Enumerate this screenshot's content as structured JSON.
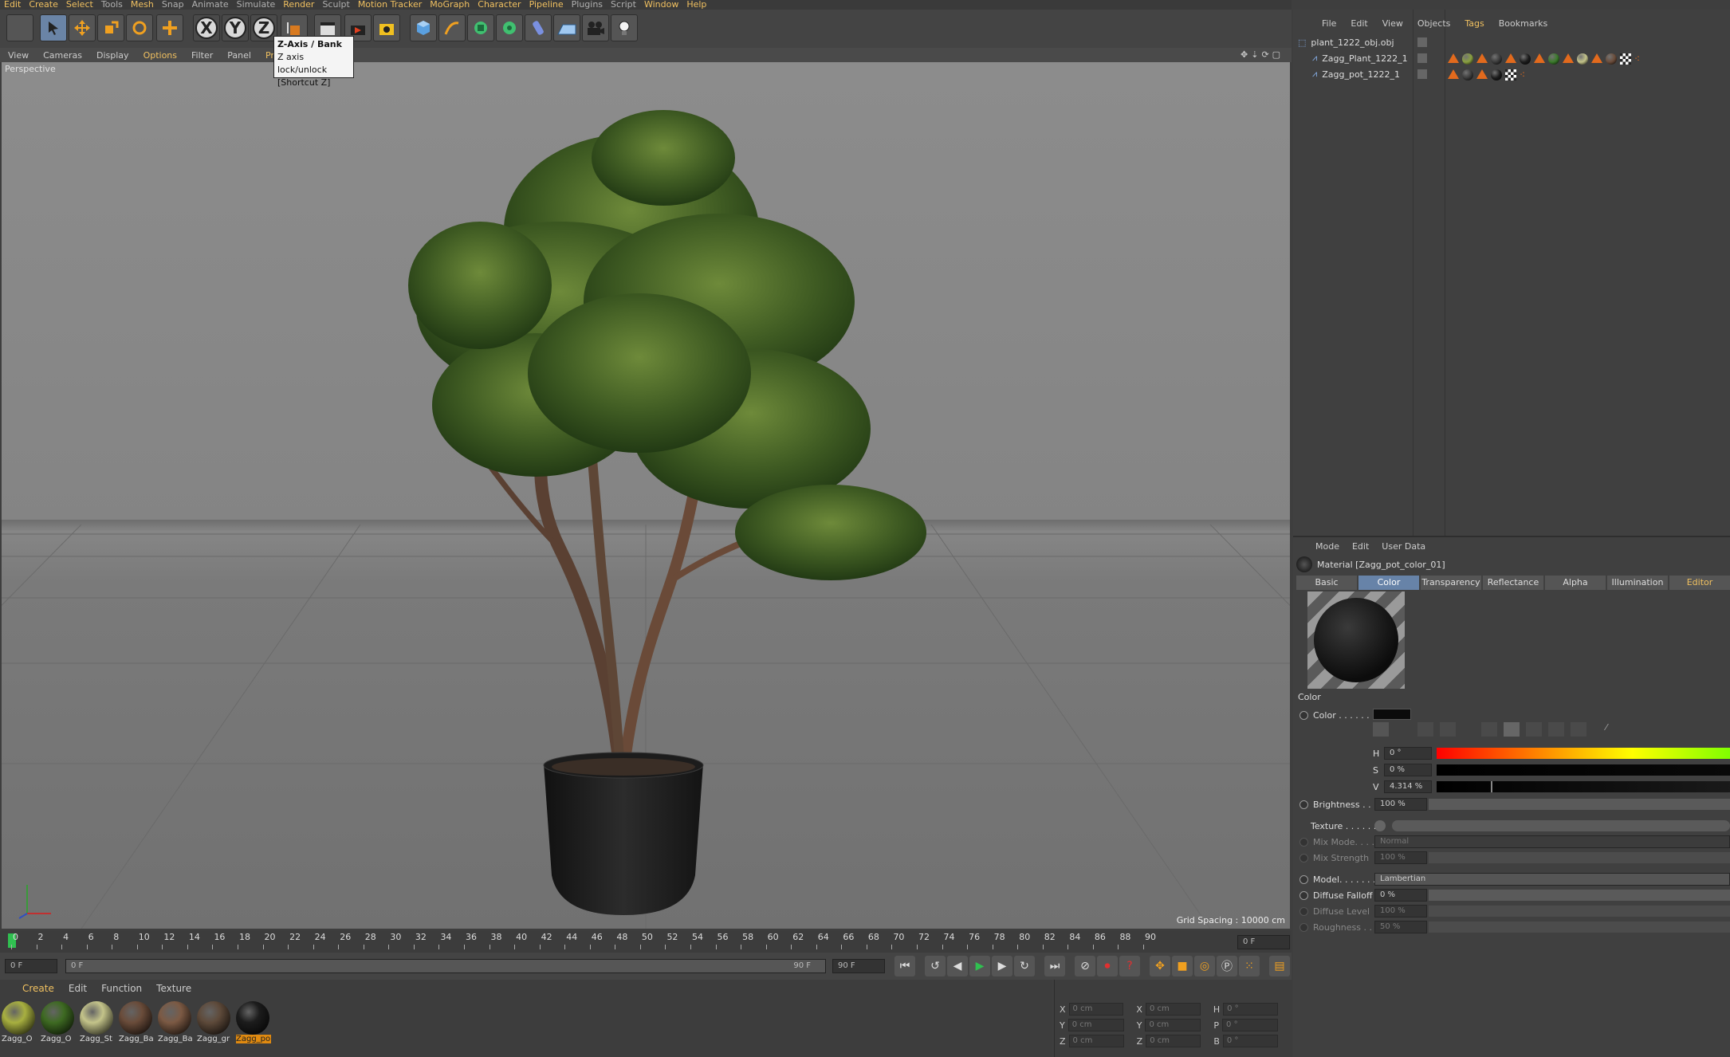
{
  "menu": [
    "Edit",
    "Create",
    "Select",
    "Tools",
    "Mesh",
    "Snap",
    "Animate",
    "Simulate",
    "Render",
    "Sculpt",
    "Motion Tracker",
    "MoGraph",
    "Character",
    "Pipeline",
    "Plugins",
    "Script",
    "Window",
    "Help"
  ],
  "tooltip": {
    "title": "Z-Axis / Bank",
    "line1": "Z axis lock/unlock",
    "line2": "[Shortcut Z]"
  },
  "toolbar": {
    "axis_x": "X",
    "axis_y": "Y",
    "axis_z": "Z"
  },
  "viewport_menu": [
    "View",
    "Cameras",
    "Display",
    "Options",
    "Filter",
    "Panel",
    "ProRe"
  ],
  "viewport": {
    "label": "Perspective",
    "grid_spacing": "Grid Spacing : 10000 cm"
  },
  "timeline": {
    "ticks": [
      "0",
      "2",
      "4",
      "6",
      "8",
      "10",
      "12",
      "14",
      "16",
      "18",
      "20",
      "22",
      "24",
      "26",
      "28",
      "30",
      "32",
      "34",
      "36",
      "38",
      "40",
      "42",
      "44",
      "46",
      "48",
      "50",
      "52",
      "54",
      "56",
      "58",
      "60",
      "62",
      "64",
      "66",
      "68",
      "70",
      "72",
      "74",
      "76",
      "78",
      "80",
      "82",
      "84",
      "86",
      "88",
      "90"
    ],
    "current_frame": "0 F"
  },
  "transport": {
    "start": "0 F",
    "range_start": "0 F",
    "range_end": "90 F",
    "end": "90 F"
  },
  "material_menu": [
    "Create",
    "Edit",
    "Function",
    "Texture"
  ],
  "materials": [
    {
      "label": "Zagg_O",
      "color": "#a8b040"
    },
    {
      "label": "Zagg_O",
      "color": "#3e6a22"
    },
    {
      "label": "Zagg_St",
      "color": "#c4c48a"
    },
    {
      "label": "Zagg_Ba",
      "color": "#6a4c3a"
    },
    {
      "label": "Zagg_Ba",
      "color": "#7c5a44"
    },
    {
      "label": "Zagg_gr",
      "color": "#5e4a3a"
    },
    {
      "label": "Zagg_po",
      "color": "#1c1c1c"
    }
  ],
  "coords": {
    "rows": [
      {
        "a": "X",
        "av": "0 cm",
        "b": "X",
        "bv": "0 cm",
        "c": "H",
        "cv": "0 °"
      },
      {
        "a": "Y",
        "av": "0 cm",
        "b": "Y",
        "bv": "0 cm",
        "c": "P",
        "cv": "0 °"
      },
      {
        "a": "Z",
        "av": "0 cm",
        "b": "Z",
        "bv": "0 cm",
        "c": "B",
        "cv": "0 °"
      }
    ]
  },
  "object_menu": [
    "File",
    "Edit",
    "View",
    "Objects",
    "Tags",
    "Bookmarks"
  ],
  "objects": [
    {
      "name": "plant_1222_obj.obj"
    },
    {
      "name": "Zagg_Plant_1222_1"
    },
    {
      "name": "Zagg_pot_1222_1"
    }
  ],
  "attr_menu": [
    "Mode",
    "Edit",
    "User Data"
  ],
  "material_title": "Material [Zagg_pot_color_01]",
  "tabs": [
    "Basic",
    "Color",
    "Transparency",
    "Reflectance",
    "Alpha",
    "Illumination",
    "Editor"
  ],
  "section": "Color",
  "props": {
    "color_label": "Color . . . . . .",
    "h_label": "H",
    "h_val": "0 °",
    "s_label": "S",
    "s_val": "0 %",
    "v_label": "V",
    "v_val": "4.314 %",
    "brightness_label": "Brightness . . .",
    "brightness_val": "100 %",
    "texture_label": "Texture . . . . . .",
    "mixmode_label": "Mix Mode. . . . .",
    "mixmode_val": "Normal",
    "mixstrength_label": "Mix Strength",
    "mixstrength_val": "100 %",
    "model_label": "Model. . . . . . . .",
    "model_val": "Lambertian",
    "diffuse_falloff_label": "Diffuse Falloff",
    "diffuse_falloff_val": "0 %",
    "diffuse_level_label": "Diffuse Level",
    "diffuse_level_val": "100 %",
    "roughness_label": "Roughness . .",
    "roughness_val": "50 %"
  }
}
